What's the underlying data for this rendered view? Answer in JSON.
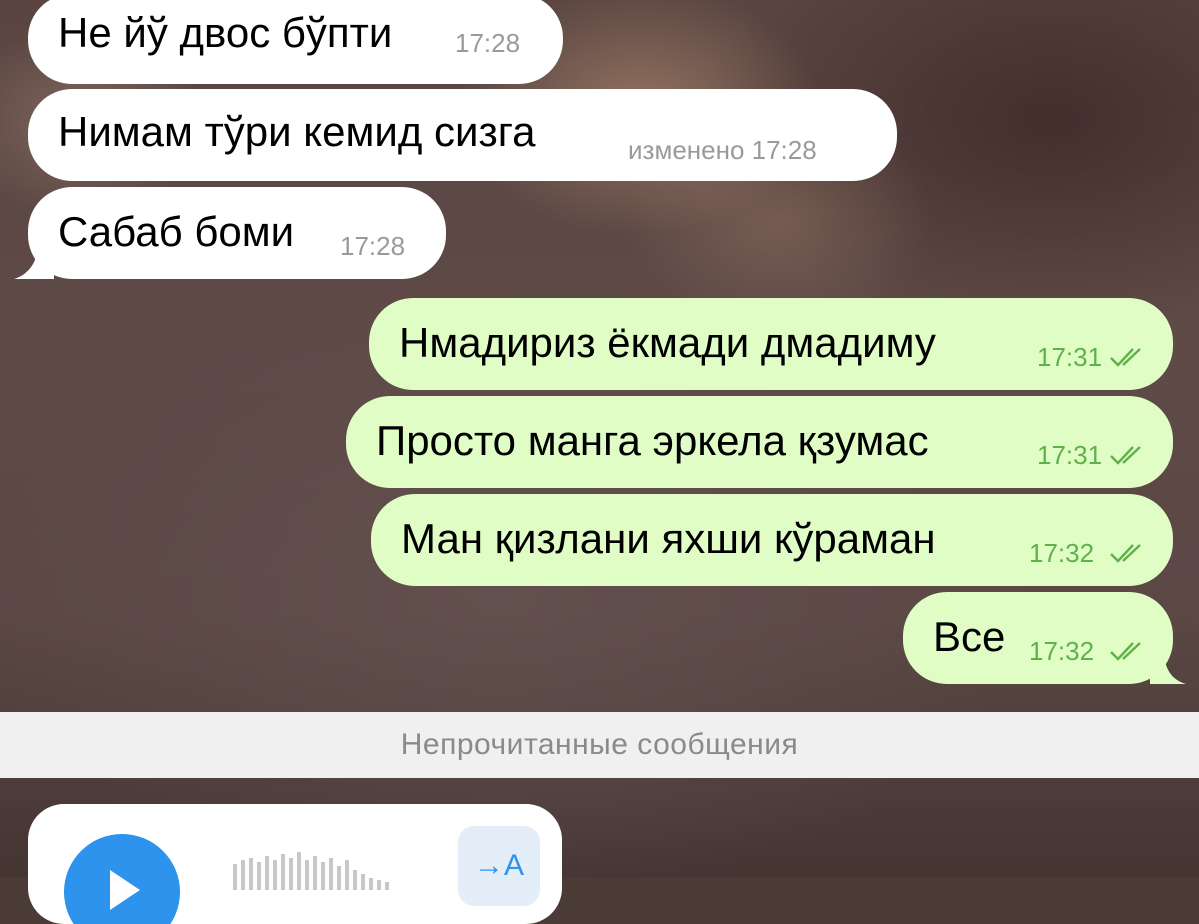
{
  "chat": {
    "incoming": [
      {
        "text": "Не йў двос бўпти",
        "time": "17:28"
      },
      {
        "text": "Нимам тўри кемид сизга",
        "time": "изменено 17:28"
      },
      {
        "text": "Сабаб боми",
        "time": "17:28"
      }
    ],
    "outgoing": [
      {
        "text": "Нмадириз ёкмади дмадиму",
        "time": "17:31",
        "status": "read"
      },
      {
        "text": "Просто манга эркела қзумас",
        "time": "17:31",
        "status": "read"
      },
      {
        "text": "Ман қизлани яхши кўраман",
        "time": "17:32",
        "status": "read"
      },
      {
        "text": "Все",
        "time": "17:32",
        "status": "read"
      }
    ]
  },
  "unread_divider": {
    "label": "Непрочитанные сообщения"
  },
  "voice_message": {
    "play_icon": "play-icon",
    "transcribe_label": "→A"
  },
  "colors": {
    "incoming_bubble": "#ffffff",
    "outgoing_bubble": "#e1fdc6",
    "outgoing_time": "#5fb14a",
    "incoming_time": "#9a9a9a",
    "accent": "#2d93ec"
  }
}
